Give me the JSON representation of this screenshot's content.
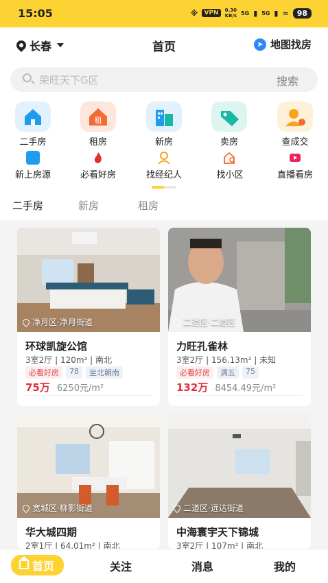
{
  "status_bar": {
    "time": "15:05",
    "vpn": "VPN",
    "net_speed_value": "0.30",
    "net_speed_unit": "KB/s",
    "signal1": "5G",
    "signal2": "5G",
    "battery": "98"
  },
  "header": {
    "city": "长春",
    "title": "首页",
    "map_search": "地图找房"
  },
  "search": {
    "placeholder": "荣旺天下G区",
    "button": "搜索"
  },
  "main_icons": [
    {
      "label": "二手房",
      "icon": "house-icon",
      "color": "#1e9cef"
    },
    {
      "label": "租房",
      "icon": "rent-house-icon",
      "color": "#f36a32"
    },
    {
      "label": "新房",
      "icon": "building-icon",
      "color": "#1e9cef"
    },
    {
      "label": "卖房",
      "icon": "price-tag-icon",
      "color": "#19b8a5"
    },
    {
      "label": "查成交",
      "icon": "deal-icon",
      "color": "#f7a51c"
    }
  ],
  "sub_icons": [
    {
      "label": "新上房源",
      "icon": "new-listing-icon",
      "color": "#1e9cef"
    },
    {
      "label": "必看好房",
      "icon": "flame-icon",
      "color": "#e03030"
    },
    {
      "label": "找经纪人",
      "icon": "agent-icon",
      "color": "#f7a51c"
    },
    {
      "label": "找小区",
      "icon": "community-search-icon",
      "color": "#f36a32"
    },
    {
      "label": "直播看房",
      "icon": "live-video-icon",
      "color": "#e8265a"
    }
  ],
  "tabs": [
    {
      "label": "二手房",
      "active": true
    },
    {
      "label": "新房",
      "active": false
    },
    {
      "label": "租房",
      "active": false
    }
  ],
  "listings": [
    {
      "location": "净月区·净月街道",
      "name": "环球凯旋公馆",
      "info": "3室2厅 | 120m² | 南北",
      "tags": [
        "必看好房",
        "78",
        "坐北朝南"
      ],
      "price": "75万",
      "unit_price": "6250元/m²"
    },
    {
      "location": "二道区·二道区",
      "name": "力旺孔雀林",
      "info": "3室2厅 | 156.13m² | 未知",
      "tags": [
        "必看好房",
        "满五",
        "75"
      ],
      "price": "132万",
      "unit_price": "8454.49元/m²"
    },
    {
      "location": "宽城区·柳影街道",
      "name": "华大城四期",
      "info": "2室1厅 | 64.01m² | 南北"
    },
    {
      "location": "二道区·远达街道",
      "name": "中海寰宇天下锦城",
      "info": "3室2厅 | 107m² | 南北"
    }
  ],
  "bottom_nav": [
    {
      "label": "首页",
      "active": true
    },
    {
      "label": "关注",
      "active": false
    },
    {
      "label": "消息",
      "active": false
    },
    {
      "label": "我的",
      "active": false
    }
  ],
  "colors": {
    "brand_yellow": "#fdd233",
    "price_red": "#e0303b"
  }
}
